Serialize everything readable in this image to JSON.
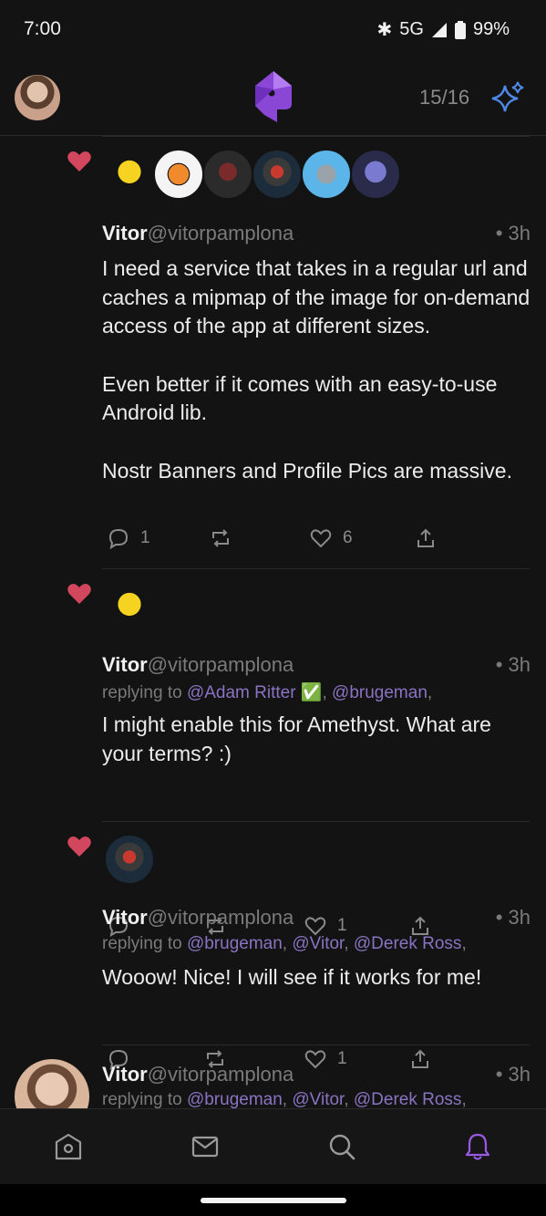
{
  "status": {
    "time": "7:00",
    "network": "5G",
    "battery": "99%"
  },
  "header": {
    "counter": "15/16",
    "logo_icon": "amethyst-logo-icon",
    "action_icon": "sparkle-icon"
  },
  "colors": {
    "heart": "#d2475e",
    "accent": "#9a5ae6",
    "mention": "#8a73c2",
    "sparkle": "#4f89e8"
  },
  "notes": [
    {
      "name": "Vitor",
      "handle": "@vitorpamplona",
      "time": "• 3h",
      "paragraphs": [
        "I need a service that takes in a regular url and caches a mipmap of the image for on-demand access of the app at different sizes.",
        "Even better if it comes with an easy-to-use Android lib.",
        "Nostr Banners and Profile Pics are massive."
      ],
      "replies": "1",
      "likes": "6"
    },
    {
      "name": "Vitor",
      "handle": "@vitorpamplona",
      "time": "• 3h",
      "reply_prefix": "replying to ",
      "mentions": [
        "@Adam Ritter ✅",
        "@brugeman"
      ],
      "text": "I might enable this for Amethyst. What are your terms? :)",
      "likes": "1"
    },
    {
      "name": "Vitor",
      "handle": "@vitorpamplona",
      "time": "• 3h",
      "reply_prefix": "replying to ",
      "mentions": [
        "@brugeman",
        "@Vitor",
        "@Derek Ross"
      ],
      "text": "Wooow! Nice! I will see if it works for me!",
      "likes": "1"
    },
    {
      "name": "Vitor",
      "handle": "@vitorpamplona",
      "time": "• 3h",
      "reply_prefix": "replying to ",
      "mentions": [
        "@brugeman",
        "@Vitor",
        "@Derek Ross"
      ]
    }
  ],
  "nav": [
    "home-icon",
    "messages-icon",
    "search-icon",
    "notifications-icon"
  ]
}
